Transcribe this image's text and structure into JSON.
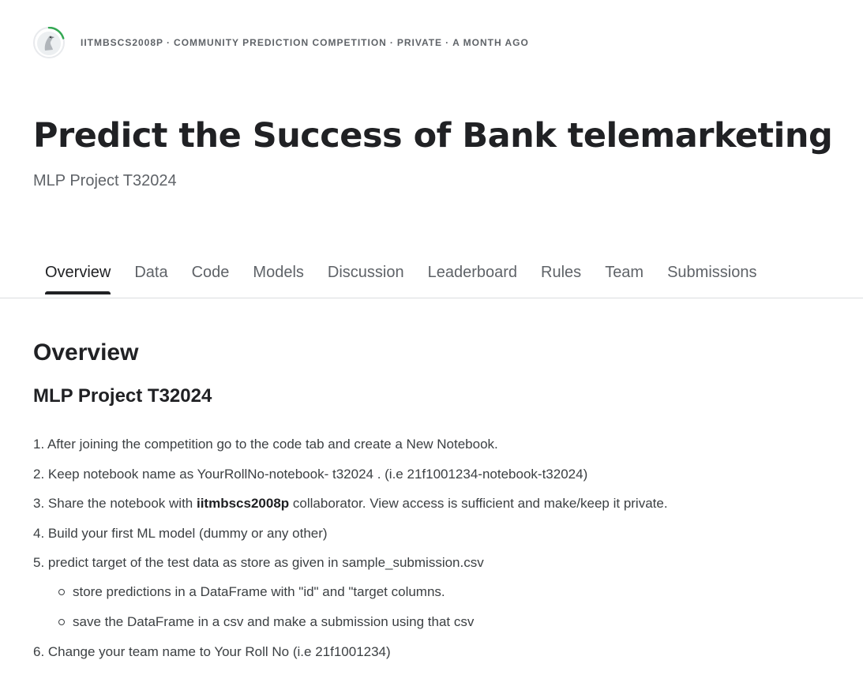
{
  "header": {
    "owner": "iitmbscs2008p",
    "competition_type": "Community Prediction Competition",
    "visibility": "Private",
    "age": "a month ago",
    "separator": "·",
    "avatar_icon": "goose-avatar-icon"
  },
  "competition": {
    "title": "Predict the Success of Bank telemarketing",
    "subtitle": "MLP Project T32024"
  },
  "tabs": [
    {
      "label": "Overview",
      "active": true
    },
    {
      "label": "Data"
    },
    {
      "label": "Code"
    },
    {
      "label": "Models"
    },
    {
      "label": "Discussion"
    },
    {
      "label": "Leaderboard"
    },
    {
      "label": "Rules"
    },
    {
      "label": "Team"
    },
    {
      "label": "Submissions"
    }
  ],
  "content": {
    "heading": "Overview",
    "subheading": "MLP Project T32024",
    "steps": {
      "s1": "1. After joining the competition go to the code tab and create a New Notebook.",
      "s2": "2. Keep notebook name as YourRollNo-notebook- t32024 . (i.e 21f1001234-notebook-t32024)",
      "s3_pre": "3. Share the notebook with ",
      "s3_bold": "iitmbscs2008p",
      "s3_post": " collaborator. View access is sufficient and make/keep it private.",
      "s4": "4. Build your first ML model (dummy or any other)",
      "s5": "5. predict target of the test data as store as given in sample_submission.csv",
      "s5_sub1": "store predictions in a DataFrame with \"id\" and \"target columns.",
      "s5_sub2": "save the DataFrame in a csv and make a submission using that csv",
      "s6": "6. Change your team name to Your Roll No (i.e 21f1001234)"
    }
  },
  "colors": {
    "accent_ring": "#20BEFF",
    "progress_green": "#34A853",
    "text_primary": "#202124",
    "text_secondary": "#5F6368"
  }
}
